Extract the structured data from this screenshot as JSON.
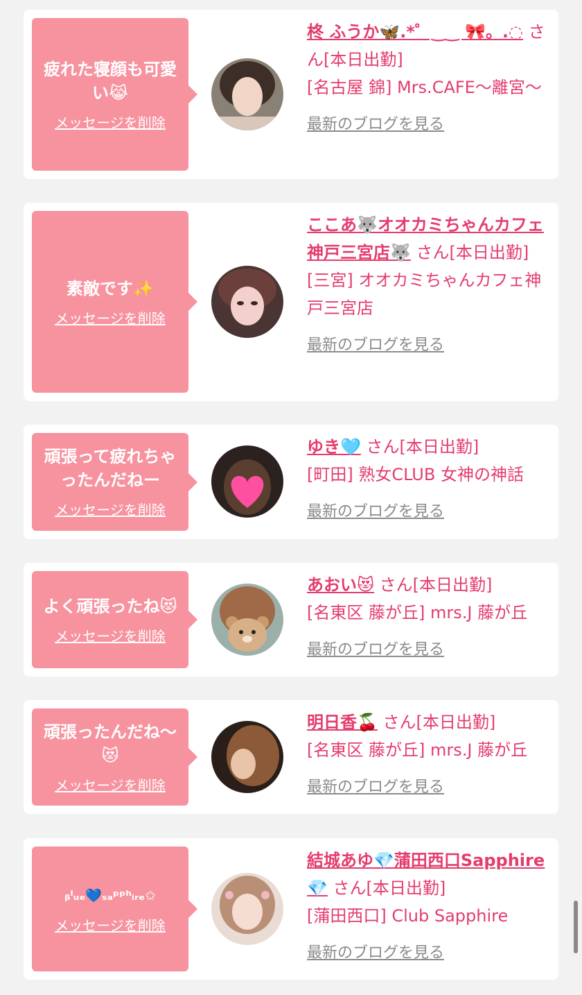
{
  "messages": [
    {
      "message": "疲れた寝顔も可愛い😹",
      "delete_label": "メッセージを削除",
      "cast_name": "柊 ふうか🦋.*゜‿‿ 🎀。.◌",
      "suffix": "さん[本日出勤]",
      "shop": "[名古屋 錦] Mrs.CAFE～離宮～",
      "blog_label": "最新のブログを見る"
    },
    {
      "message": "素敵です✨",
      "delete_label": "メッセージを削除",
      "cast_name": "ここあ🐺オオカミちゃんカフェ神戸三宮店🐺",
      "suffix": "さん[本日出勤]",
      "shop": "[三宮] オオカミちゃんカフェ神戸三宮店",
      "blog_label": "最新のブログを見る"
    },
    {
      "message": "頑張って疲れちゃったんだねー",
      "delete_label": "メッセージを削除",
      "cast_name": "ゆき🩵",
      "suffix": "さん[本日出勤]",
      "shop": "[町田] 熟女CLUB 女神の神話",
      "blog_label": "最新のブログを見る"
    },
    {
      "message": "よく頑張ったね😻",
      "delete_label": "メッセージを削除",
      "cast_name": "あおい😻",
      "suffix": "さん[本日出勤]",
      "shop": "[名東区 藤が丘] mrs.J 藤が丘",
      "blog_label": "最新のブログを見る"
    },
    {
      "message": "頑張ったんだね～😻",
      "delete_label": "メッセージを削除",
      "cast_name": "明日香🍒",
      "suffix": "さん[本日出勤]",
      "shop": "[名東区 藤が丘] mrs.J 藤が丘",
      "blog_label": "最新のブログを見る"
    },
    {
      "message": "ᵦˡᵤₑ💙ₛₐᵖᵖʰᵢᵣₑ✩",
      "delete_label": "メッセージを削除",
      "cast_name": "結城あゆ💎蒲田西口Sapphire💎",
      "suffix": "さん[本日出勤]",
      "shop": "[蒲田西口] Club Sapphire",
      "blog_label": "最新のブログを見る"
    }
  ]
}
